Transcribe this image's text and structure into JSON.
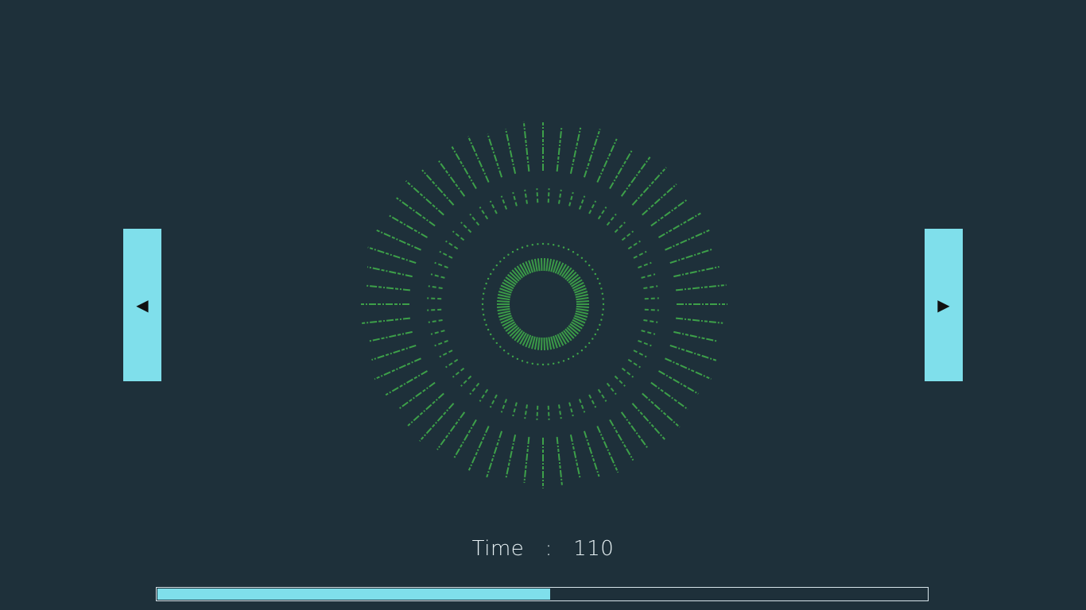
{
  "controls": {
    "prev_icon": "left-triangle-icon",
    "prev_glyph": "◀",
    "next_icon": "right-triangle-icon",
    "next_glyph": "▶"
  },
  "time": {
    "label": "Time",
    "separator": ":",
    "value": "110"
  },
  "progress": {
    "fraction": 0.51
  },
  "colors": {
    "background": "#1e303a",
    "accent": "#7fdfeb",
    "visualizer": "#3fa64a"
  }
}
